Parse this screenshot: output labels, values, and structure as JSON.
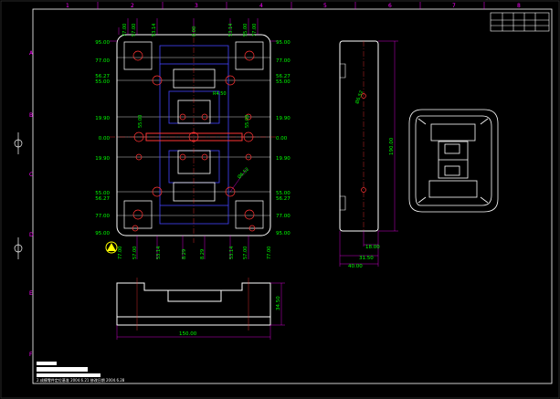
{
  "frame": {
    "col_numbers": [
      "1",
      "2",
      "3",
      "4",
      "5",
      "6",
      "7",
      "8"
    ],
    "row_letters": [
      "A",
      "B",
      "C",
      "D",
      "E",
      "F"
    ]
  },
  "title_block": {
    "headers": [
      "",
      "",
      "",
      "",
      ""
    ],
    "footer_text": "2.成模零件定位基准 2004.6.21  修改日期 2004.6.28"
  },
  "dims": {
    "left_y": [
      "95.00",
      "77.00",
      "56.27",
      "55.00",
      "19.90",
      "0.00",
      "19.90",
      "55.00",
      "56.27",
      "77.00",
      "95.00"
    ],
    "right_y": [
      "95.00",
      "77.00",
      "56.27",
      "55.00",
      "19.90",
      "0.00",
      "19.90",
      "55.00",
      "56.27",
      "77.00",
      "95.00"
    ],
    "top_x": [
      "77.00",
      "57.00",
      "53.14",
      "0.00",
      "53.14",
      "55.00",
      "77.00"
    ],
    "bottom_x": [
      "77.00",
      "57.00",
      "53.14",
      "8.29",
      "8.29",
      "53.14",
      "57.00",
      "77.00"
    ],
    "inner": [
      "55.00",
      "55.00",
      "R4.50"
    ],
    "dia_label": "Ø6.52",
    "side_height": "190.00",
    "side_w1": "18.00",
    "side_w2": "31.50",
    "side_w3": "40.00",
    "front_width": "150.00",
    "front_height": "34.50",
    "hole_label": "Ø6.52"
  },
  "colors": {
    "outline": "#ffffff",
    "dim_text": "#00ff00",
    "dim_line": "#ff00ff",
    "hidden": "#4444ff",
    "center": "#ff3333",
    "frame": "#ffffff"
  }
}
